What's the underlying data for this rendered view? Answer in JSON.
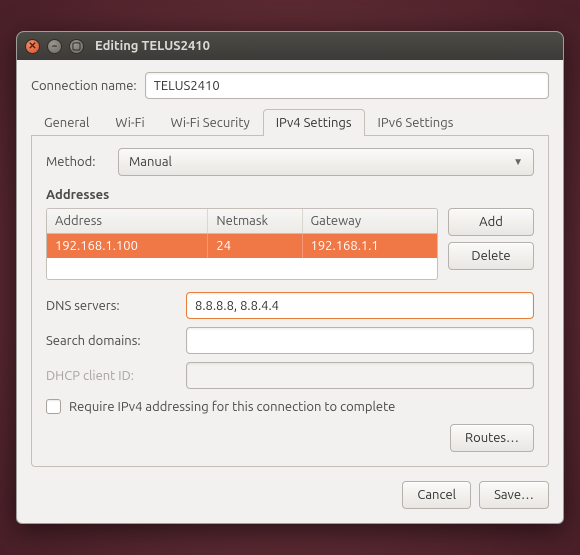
{
  "window": {
    "title": "Editing TELUS2410"
  },
  "conn_name": {
    "label": "Connection name:",
    "value": "TELUS2410"
  },
  "tabs": [
    {
      "label": "General"
    },
    {
      "label": "Wi-Fi"
    },
    {
      "label": "Wi-Fi Security"
    },
    {
      "label": "IPv4 Settings",
      "active": true
    },
    {
      "label": "IPv6 Settings"
    }
  ],
  "method": {
    "label": "Method:",
    "value": "Manual"
  },
  "addresses": {
    "title": "Addresses",
    "columns": [
      "Address",
      "Netmask",
      "Gateway"
    ],
    "rows": [
      {
        "address": "192.168.1.100",
        "netmask": "24",
        "gateway": "192.168.1.1"
      }
    ],
    "add_label": "Add",
    "delete_label": "Delete"
  },
  "dns": {
    "label": "DNS servers:",
    "value": "8.8.8.8, 8.8.4.4"
  },
  "search": {
    "label": "Search domains:",
    "value": ""
  },
  "dhcp": {
    "label": "DHCP client ID:",
    "value": ""
  },
  "require_checkbox": {
    "label": "Require IPv4 addressing for this connection to complete",
    "checked": false
  },
  "routes_label": "Routes…",
  "footer": {
    "cancel": "Cancel",
    "save": "Save…"
  }
}
